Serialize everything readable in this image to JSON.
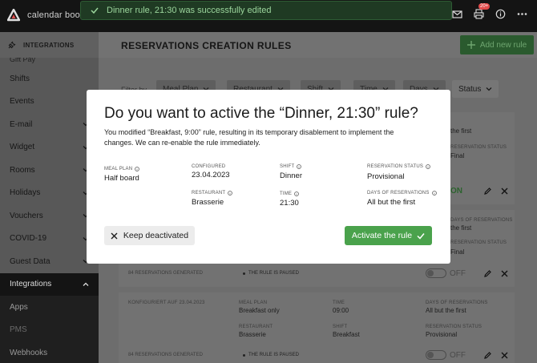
{
  "topbar": {
    "brand": "calendar  book",
    "notif_badge": "20+"
  },
  "toast": {
    "message": "Dinner rule, 21:30 was successfully edited"
  },
  "sidebar": {
    "header": "INTEGRATIONS",
    "cut_item": "Gift Pay",
    "items": [
      {
        "label": "Shifts",
        "chevron": false
      },
      {
        "label": "Events",
        "chevron": false
      },
      {
        "label": "E-mail",
        "chevron": true
      },
      {
        "label": "Widget",
        "chevron": true
      },
      {
        "label": "Rooms",
        "chevron": true
      },
      {
        "label": "Holidays",
        "chevron": true
      },
      {
        "label": "Vouchers",
        "chevron": true
      },
      {
        "label": "COVID-19",
        "chevron": true
      },
      {
        "label": "Guest Data",
        "chevron": true
      },
      {
        "label": "Integrations",
        "chevron": true
      }
    ],
    "subitems": [
      "Apps",
      "PMS",
      "Webhooks"
    ]
  },
  "main": {
    "title": "RESERVATIONS CREATION RULES",
    "add_button": "Add new rule",
    "filter_label": "Filter by",
    "filters": [
      "Meal Plan",
      "Restaurant",
      "Shift",
      "Time",
      "Days",
      "Status"
    ]
  },
  "background_cards": {
    "peek": {
      "first_only": "the first",
      "status_cap": "RESERVATION STATUS",
      "status_val": "Final",
      "on_label": "ON",
      "days_cap": "DAYS OF RESERVATIONS",
      "first2": "the first",
      "status2_val": "Final"
    },
    "card2": {
      "generated": "84 RESERVATIONS GENERATED",
      "paused": "THE RULE IS PAUSED",
      "off": "OFF"
    },
    "card3": {
      "configured": "KONFIGURIERT AUF 23.04.2023",
      "meal_cap": "MEAL PLAN",
      "meal_val": "Breakfast only",
      "time_cap": "TIME",
      "time_val": "09:00",
      "days_cap": "DAYS OF RESERVATIONS",
      "days_val": "All but the first",
      "rest_cap": "RESTAURANT",
      "rest_val": "Brasserie",
      "shift_cap": "SHIFT",
      "shift_val": "Breakfast",
      "status_cap": "RESERVATION STATUS",
      "status_val": "Provisional",
      "generated": "84 RESERVATIONS GENERATED",
      "paused": "THE RULE IS PAUSED",
      "off": "OFF"
    }
  },
  "modal": {
    "title": "Do you want to active the “Dinner, 21:30” rule?",
    "description": "You modified “Breakfast, 9:00” rule, resulting in its temporary disablement to implement the changes. We can re-enable the rule immediately.",
    "fields": {
      "meal_plan": {
        "label": "MEAL PLAN",
        "value": "Half board"
      },
      "configured": {
        "label": "CONFIGURED",
        "value": "23.04.2023"
      },
      "shift": {
        "label": "SHIFT",
        "value": "Dinner"
      },
      "reservation_status": {
        "label": "RESERVATION STATUS",
        "value": "Provisional"
      },
      "restaurant": {
        "label": "RESTAURANT",
        "value": "Brasserie"
      },
      "time": {
        "label": "TIME",
        "value": "21:30"
      },
      "days": {
        "label": "DAYS OF RESERVATIONS",
        "value": "All but the first"
      }
    },
    "keep_button": "Keep deactivated",
    "activate_button": "Activate the rule"
  },
  "colors": {
    "accent_green": "#4aa24c",
    "toast_bg": "#1f3a23",
    "sidebar_active": "#141414"
  }
}
